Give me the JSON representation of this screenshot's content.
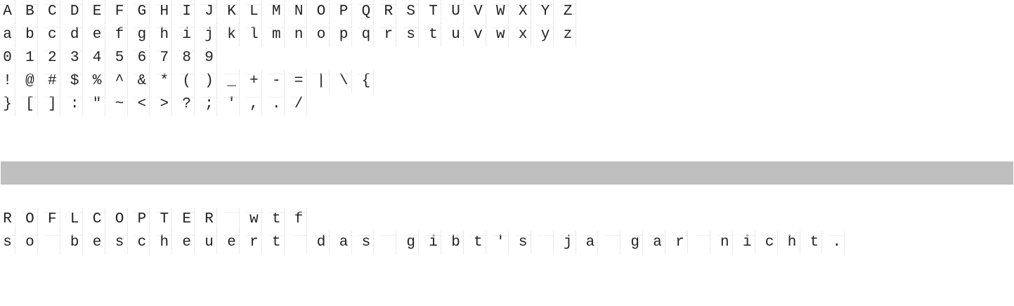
{
  "top_rows": [
    [
      "A",
      "B",
      "C",
      "D",
      "E",
      "F",
      "G",
      "H",
      "I",
      "J",
      "K",
      "L",
      "M",
      "N",
      "O",
      "P",
      "Q",
      "R",
      "S",
      "T",
      "U",
      "V",
      "W",
      "X",
      "Y",
      "Z"
    ],
    [
      "a",
      "b",
      "c",
      "d",
      "e",
      "f",
      "g",
      "h",
      "i",
      "j",
      "k",
      "l",
      "m",
      "n",
      "o",
      "p",
      "q",
      "r",
      "s",
      "t",
      "u",
      "v",
      "w",
      "x",
      "y",
      "z"
    ],
    [
      "0",
      "1",
      "2",
      "3",
      "4",
      "5",
      "6",
      "7",
      "8",
      "9"
    ],
    [
      "!",
      "@",
      "#",
      "$",
      "%",
      "^",
      "&",
      "*",
      "(",
      ")",
      "_",
      "+",
      "-",
      "=",
      "|",
      "\\",
      "{"
    ],
    [
      "}",
      "[",
      "]",
      ":",
      "\"",
      "~",
      "<",
      ">",
      "?",
      ";",
      "'",
      ",",
      ".",
      "/"
    ]
  ],
  "bottom_rows": [
    [
      "R",
      "O",
      "F",
      "L",
      "C",
      "O",
      "P",
      "T",
      "E",
      "R",
      " ",
      "w",
      "t",
      "f"
    ],
    [
      "s",
      "o",
      " ",
      "b",
      "e",
      "s",
      "c",
      "h",
      "e",
      "u",
      "e",
      "r",
      "t",
      " ",
      "d",
      "a",
      "s",
      " ",
      "g",
      "i",
      "b",
      "t",
      "'",
      "s",
      " ",
      "j",
      "a",
      " ",
      "g",
      "a",
      "r",
      " ",
      "n",
      "i",
      "c",
      "h",
      "t",
      "."
    ]
  ]
}
